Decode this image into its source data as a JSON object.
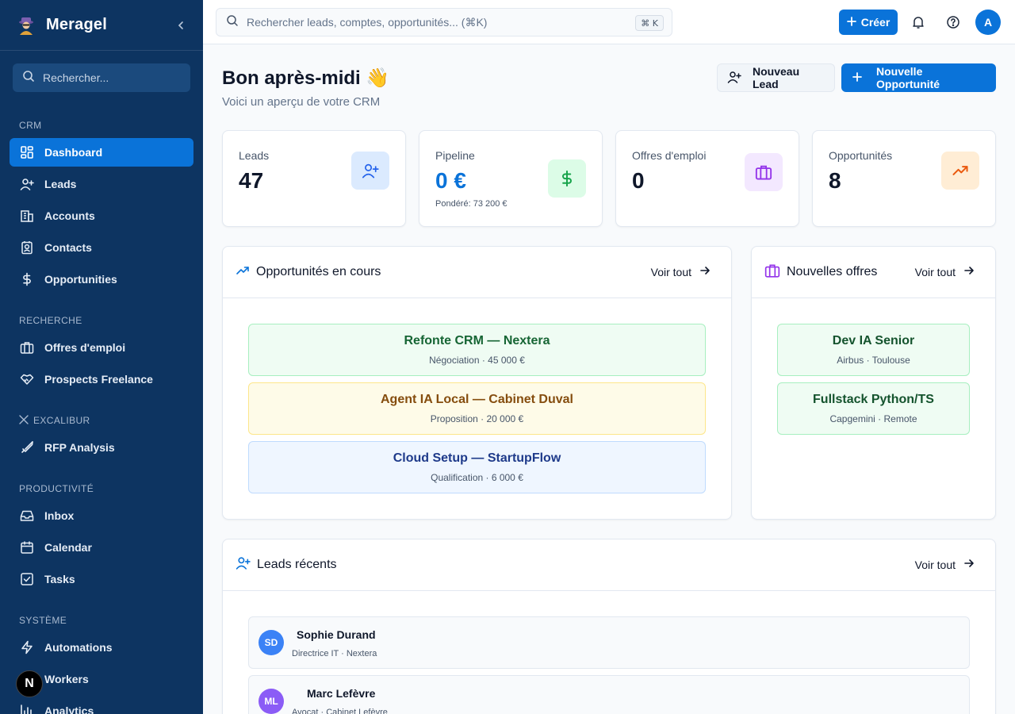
{
  "app": {
    "name": "Meragel"
  },
  "sidebar": {
    "search_placeholder": "Rechercher...",
    "sections": {
      "crm": "CRM",
      "recherche": "RECHERCHE",
      "excalibur": "EXCALIBUR",
      "productivite": "PRODUCTIVITÉ",
      "systeme": "SYSTÈME"
    },
    "items": {
      "dashboard": "Dashboard",
      "leads": "Leads",
      "accounts": "Accounts",
      "contacts": "Contacts",
      "opportunities": "Opportunities",
      "offres": "Offres d'emploi",
      "prospects": "Prospects Freelance",
      "rfp": "RFP Analysis",
      "inbox": "Inbox",
      "calendar": "Calendar",
      "tasks": "Tasks",
      "automations": "Automations",
      "workers": "Workers",
      "analytics": "Analytics"
    },
    "badge": "N"
  },
  "topbar": {
    "search_placeholder": "Rechercher leads, comptes, opportunités... (⌘K)",
    "shortcut": "⌘ K",
    "create_label": "Créer",
    "avatar_initial": "A"
  },
  "header": {
    "title": "Bon après-midi 👋",
    "subtitle": "Voici un aperçu de votre CRM",
    "new_lead_label": "Nouveau Lead",
    "new_opp_label": "Nouvelle Opportunité"
  },
  "stats": [
    {
      "label": "Leads",
      "value": "47",
      "note": ""
    },
    {
      "label": "Pipeline",
      "value": "0 €",
      "note": "Pondéré: 73 200 €"
    },
    {
      "label": "Offres d'emploi",
      "value": "0",
      "note": ""
    },
    {
      "label": "Opportunités",
      "value": "8",
      "note": ""
    }
  ],
  "opportunities": {
    "title": "Opportunités en cours",
    "see_all": "Voir tout",
    "items": [
      {
        "title": "Refonte CRM — Nextera",
        "sub": "Négociation · 45 000 €"
      },
      {
        "title": "Agent IA Local — Cabinet Duval",
        "sub": "Proposition · 20 000 €"
      },
      {
        "title": "Cloud Setup — StartupFlow",
        "sub": "Qualification · 6 000 €"
      }
    ]
  },
  "offers": {
    "title": "Nouvelles offres",
    "see_all": "Voir tout",
    "items": [
      {
        "title": "Dev IA Senior",
        "sub": "Airbus · Toulouse"
      },
      {
        "title": "Fullstack Python/TS",
        "sub": "Capgemini · Remote"
      }
    ]
  },
  "recent_leads": {
    "title": "Leads récents",
    "see_all": "Voir tout",
    "items": [
      {
        "initials": "SD",
        "name": "Sophie Durand",
        "sub": "Directrice IT · Nextera"
      },
      {
        "initials": "ML",
        "name": "Marc Lefèvre",
        "sub": "Avocat · Cabinet Lefèvre"
      }
    ]
  },
  "colors": {
    "sidebar_bg": "#0d3461",
    "accent": "#0a73d9",
    "green_bg": "#effcf3",
    "yellow_bg": "#fefbe8",
    "blue_bg": "#eff6ff"
  }
}
